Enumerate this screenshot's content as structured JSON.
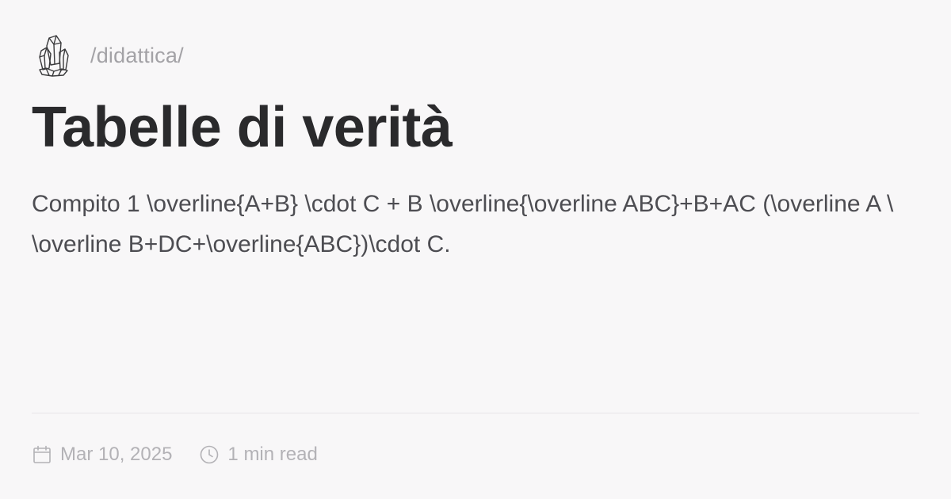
{
  "header": {
    "logo_icon": "crystal-cluster-icon",
    "breadcrumb": "/didattica/"
  },
  "post": {
    "title": "Tabelle di verità",
    "description": "Compito 1 \\overline{A+B} \\cdot C + B \\overline{\\overline ABC}+B+AC (\\overline A \\ \\overline B+DC+\\overline{ABC})\\cdot C."
  },
  "meta": {
    "date_icon": "calendar-icon",
    "date": "Mar 10, 2025",
    "read_time_icon": "clock-icon",
    "read_time": "1 min read"
  },
  "colors": {
    "background": "#f8f7f8",
    "title": "#2a2a2c",
    "text": "#4d4d52",
    "muted": "#a3a2a6"
  }
}
